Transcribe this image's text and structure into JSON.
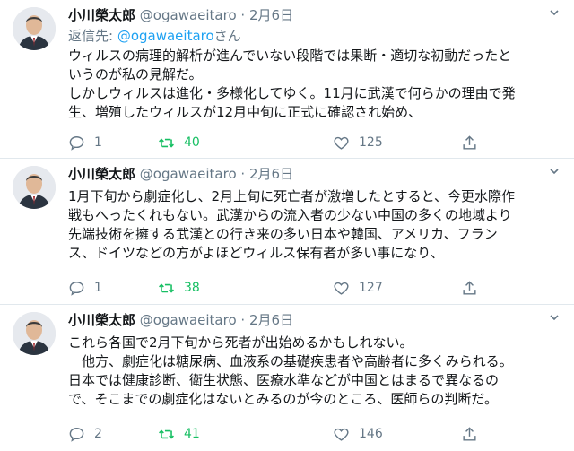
{
  "tweets": [
    {
      "name": "小川榮太郎",
      "handle": "@ogawaeitaro",
      "dot": "·",
      "date": "2月6日",
      "reply_to_prefix": "返信先: ",
      "reply_to_handle": "@ogawaeitaro",
      "reply_to_suffix": "さん",
      "lines": [
        "ウィルスの病理的解析が進んでいない段階では果断・適切な初動だったと",
        "いうのが私の見解だ。",
        "しかしウィルスは進化・多様化してゆく。11月に武漢で何らかの理由で発",
        "生、増殖したウィルスが12月中旬に正式に確認され始め、"
      ],
      "replies": "1",
      "retweets": "40",
      "likes": "125"
    },
    {
      "name": "小川榮太郎",
      "handle": "@ogawaeitaro",
      "dot": "·",
      "date": "2月6日",
      "lines": [
        "1月下旬から劇症化し、2月上旬に死亡者が激増したとすると、今更水際作",
        "戦もへったくれもない。武漢からの流入者の少ない中国の多くの地域より",
        "先端技術を擁する武漢との行き来の多い日本や韓国、アメリカ、フラン",
        "ス、ドイツなどの方がよほどウィルス保有者が多い事になり、"
      ],
      "replies": "1",
      "retweets": "38",
      "likes": "127"
    },
    {
      "name": "小川榮太郎",
      "handle": "@ogawaeitaro",
      "dot": "·",
      "date": "2月6日",
      "lines": [
        "これら各国で2月下旬から死者が出始めるかもしれない。",
        "　他方、劇症化は糖尿病、血液系の基礎疾患者や高齢者に多くみられる。",
        "日本では健康診断、衛生状態、医療水準などが中国とはまるで異なるの",
        "で、そこまでの劇症化はないとみるのが今のところ、医師らの判断だ。"
      ],
      "replies": "2",
      "retweets": "41",
      "likes": "146"
    }
  ],
  "icons": {
    "caret": "chevron-down-icon",
    "reply": "reply-icon",
    "retweet": "retweet-icon",
    "like": "heart-icon",
    "share": "share-icon"
  },
  "colors": {
    "text": "#14171a",
    "meta": "#657786",
    "retweet_active": "#17bf63",
    "link": "#1da1f2"
  }
}
